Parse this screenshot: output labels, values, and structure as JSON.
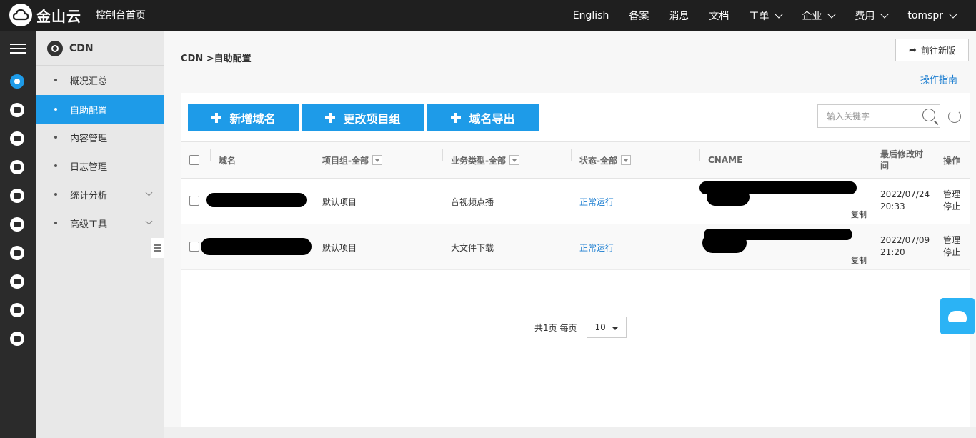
{
  "header": {
    "brand": "金山云",
    "home_link": "控制台首页",
    "nav": [
      {
        "label": "English",
        "has_dropdown": false
      },
      {
        "label": "备案",
        "has_dropdown": false
      },
      {
        "label": "消息",
        "has_dropdown": false
      },
      {
        "label": "文档",
        "has_dropdown": false
      },
      {
        "label": "工单",
        "has_dropdown": true
      },
      {
        "label": "企业",
        "has_dropdown": true
      },
      {
        "label": "费用",
        "has_dropdown": true
      },
      {
        "label": "tomspr",
        "has_dropdown": true
      }
    ]
  },
  "sidebar": {
    "title": "CDN",
    "items": [
      {
        "label": "概况汇总",
        "active": false,
        "expandable": false
      },
      {
        "label": "自助配置",
        "active": true,
        "expandable": false
      },
      {
        "label": "内容管理",
        "active": false,
        "expandable": false
      },
      {
        "label": "日志管理",
        "active": false,
        "expandable": false
      },
      {
        "label": "统计分析",
        "active": false,
        "expandable": true
      },
      {
        "label": "高级工具",
        "active": false,
        "expandable": true
      }
    ]
  },
  "main": {
    "breadcrumb": "CDN >自助配置",
    "new_version_button": "前往新版",
    "guide_link": "操作指南",
    "toolbar": {
      "add_domain": "新增域名",
      "change_project": "更改项目组",
      "export_domains": "域名导出"
    },
    "search": {
      "placeholder": "输入关键字"
    },
    "table": {
      "headers": {
        "domain": "域名",
        "project": "项目组-全部",
        "business_type": "业务类型-全部",
        "status": "状态-全部",
        "cname": "CNAME",
        "modified": "最后修改时间",
        "actions": "操作"
      },
      "rows": [
        {
          "project": "默认项目",
          "business_type": "音视频点播",
          "status": "正常运行",
          "copy": "复制",
          "date": "2022/07/24",
          "time": "20:33",
          "manage": "管理",
          "stop": "停止"
        },
        {
          "project": "默认项目",
          "business_type": "大文件下载",
          "status": "正常运行",
          "copy": "复制",
          "date": "2022/07/09",
          "time": "21:20",
          "manage": "管理",
          "stop": "停止"
        }
      ]
    },
    "pagination": {
      "summary": "共1页 每页",
      "page_size": "10"
    }
  },
  "colors": {
    "accent": "#1e9be8",
    "link": "#1e7fd1",
    "topbar": "#1f1f1f"
  }
}
